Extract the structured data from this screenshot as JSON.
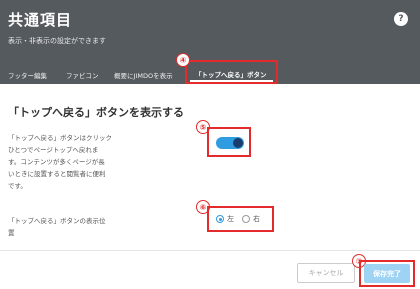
{
  "header": {
    "title": "共通項目",
    "subtitle": "表示・非表示の設定ができます",
    "help_symbol": "?"
  },
  "tabs": [
    {
      "label": "フッター編集"
    },
    {
      "label": "ファビコン"
    },
    {
      "label": "概要にJIMDOを表示"
    },
    {
      "label": "「トップへ戻る」ボタン",
      "active": true
    }
  ],
  "badges": {
    "b4": "④",
    "b5": "⑤",
    "b6": "⑥",
    "b7": "⑦"
  },
  "main": {
    "section_title": "「トップへ戻る」ボタンを表示する",
    "description_lines": [
      "「トップへ戻る」ボタンはクリック",
      "ひとつでページトップへ戻れま",
      "す。コンテンツが多くページが長",
      "いときに設置すると閲覧者に便利",
      "です。"
    ],
    "toggle_on": true,
    "position_label_lines": [
      "「トップへ戻る」ボタンの表示位",
      "置"
    ],
    "position_options": [
      "左",
      "右"
    ],
    "position_selected": "左"
  },
  "footer": {
    "cancel_label": "キャンセル",
    "save_label": "保存完了"
  },
  "colors": {
    "header_bg": "#555a5f",
    "highlight": "#e32b2b",
    "accent": "#2f9be0",
    "save_bg": "#9ed3f3"
  }
}
